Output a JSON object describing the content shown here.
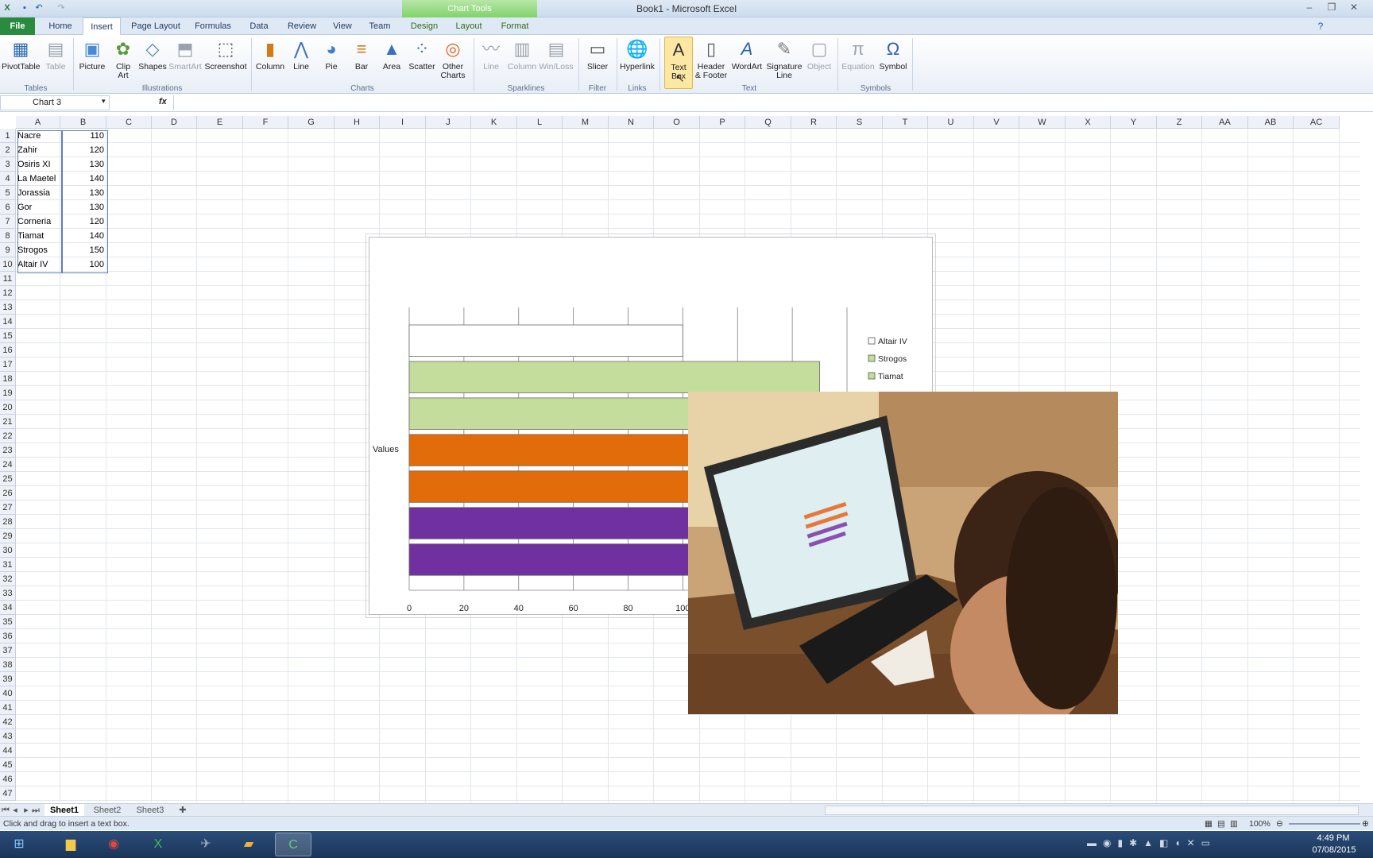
{
  "window": {
    "title": "Book1 - Microsoft Excel",
    "context_tab_group": "Chart Tools"
  },
  "tabs": [
    "File",
    "Home",
    "Insert",
    "Page Layout",
    "Formulas",
    "Data",
    "Review",
    "View",
    "Team",
    "Design",
    "Layout",
    "Format"
  ],
  "active_tab": "Insert",
  "ribbon": {
    "groups": {
      "tables": "Tables",
      "illustrations": "Illustrations",
      "charts": "Charts",
      "sparklines": "Sparklines",
      "filter": "Filter",
      "links": "Links",
      "text": "Text",
      "symbols": "Symbols"
    },
    "buttons": {
      "pivottable": "PivotTable",
      "table": "Table",
      "picture": "Picture",
      "clip_art_1": "Clip",
      "clip_art_2": "Art",
      "shapes": "Shapes",
      "smartart": "SmartArt",
      "screenshot": "Screenshot",
      "column": "Column",
      "line": "Line",
      "pie": "Pie",
      "bar": "Bar",
      "area": "Area",
      "scatter": "Scatter",
      "other_1": "Other",
      "other_2": "Charts",
      "spark_line": "Line",
      "spark_column": "Column",
      "spark_winloss": "Win/Loss",
      "slicer": "Slicer",
      "hyperlink": "Hyperlink",
      "textbox_1": "Text",
      "textbox_2": "Box",
      "header_1": "Header",
      "header_2": "& Footer",
      "wordart": "WordArt",
      "signature_1": "Signature",
      "signature_2": "Line",
      "object": "Object",
      "equation": "Equation",
      "symbol": "Symbol"
    }
  },
  "formula_bar": {
    "name_box": "Chart 3",
    "fx": "fx",
    "formula": ""
  },
  "columns": [
    "A",
    "B",
    "C",
    "D",
    "E",
    "F",
    "G",
    "H",
    "I",
    "J",
    "K",
    "L",
    "M",
    "N",
    "O",
    "P",
    "Q",
    "R",
    "S",
    "T",
    "U",
    "V",
    "W",
    "X",
    "Y",
    "Z",
    "AA",
    "AB",
    "AC"
  ],
  "rows": [
    "1",
    "2",
    "3",
    "4",
    "5",
    "6",
    "7",
    "8",
    "9",
    "10",
    "11",
    "12",
    "13",
    "14",
    "15",
    "16",
    "17",
    "18",
    "19",
    "20",
    "21",
    "22",
    "23",
    "24",
    "25",
    "26",
    "27",
    "28",
    "29",
    "30",
    "31",
    "32",
    "33",
    "34",
    "35",
    "36",
    "37",
    "38",
    "39",
    "40",
    "41",
    "42",
    "43",
    "44",
    "45",
    "46",
    "47"
  ],
  "sheet_data": [
    {
      "name": "Nacre",
      "value": "110"
    },
    {
      "name": "Zahir",
      "value": "120"
    },
    {
      "name": "Osiris XI",
      "value": "130"
    },
    {
      "name": "La Maetel",
      "value": "140"
    },
    {
      "name": "Jorassia",
      "value": "130"
    },
    {
      "name": "Gor",
      "value": "130"
    },
    {
      "name": "Corneria",
      "value": "120"
    },
    {
      "name": "Tiamat",
      "value": "140"
    },
    {
      "name": "Strogos",
      "value": "150"
    },
    {
      "name": "Altair IV",
      "value": "100"
    }
  ],
  "chart_data": {
    "type": "bar",
    "orientation": "horizontal",
    "ylabel": "Values",
    "x_ticks": [
      "0",
      "20",
      "40",
      "60",
      "80",
      "100"
    ],
    "xlim": [
      0,
      160
    ],
    "legend": [
      "Altair IV",
      "Strogos",
      "Tiamat"
    ],
    "legend_position": "right",
    "series": [
      {
        "name": "Altair IV",
        "value": 100,
        "color": "#ffffff"
      },
      {
        "name": "Strogos",
        "value": 150,
        "color": "#c4dc9c"
      },
      {
        "name": "Tiamat",
        "value": 140,
        "color": "#c4dc9c"
      },
      {
        "name": "Corneria",
        "value": 120,
        "color": "#e26b0a"
      },
      {
        "name": "Gor",
        "value": 130,
        "color": "#e26b0a"
      },
      {
        "name": "Jorassia",
        "value": 130,
        "color": "#7030a0"
      },
      {
        "name": "La Maetel",
        "value": 140,
        "color": "#7030a0"
      }
    ]
  },
  "sheet_tabs": [
    "Sheet1",
    "Sheet2",
    "Sheet3"
  ],
  "active_sheet": "Sheet1",
  "status": {
    "message": "Click and drag to insert a text box.",
    "zoom": "100%"
  },
  "taskbar": {
    "time": "4:49 PM",
    "date": "07/08/2015"
  },
  "colors": {
    "file_tab": "#2a8a3e",
    "accent": "#1e395b"
  }
}
